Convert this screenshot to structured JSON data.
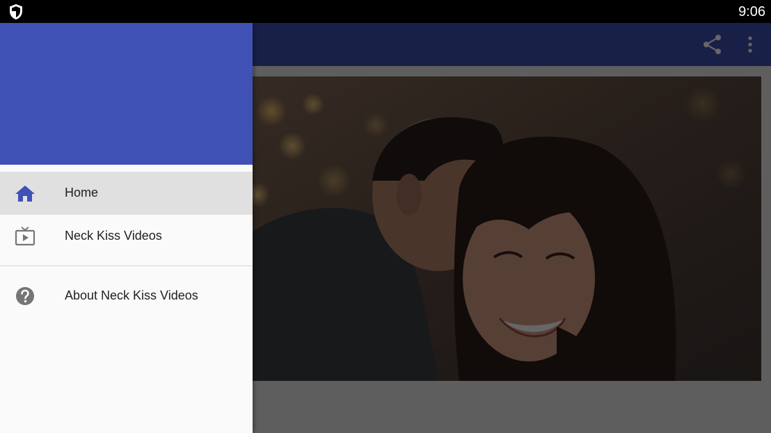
{
  "status_bar": {
    "time": "9:06",
    "security_icon": "shield-icon"
  },
  "app_bar": {
    "color": "#3f51b5",
    "actions": [
      {
        "icon": "share-icon"
      },
      {
        "icon": "more-vert-icon"
      }
    ]
  },
  "content": {
    "image": "couple-embrace-photo"
  },
  "drawer": {
    "header_color": "#3f51b5",
    "items": [
      {
        "label": "Home",
        "icon": "home-icon",
        "selected": true
      },
      {
        "label": "Neck Kiss Videos",
        "icon": "live-tv-icon",
        "selected": false
      },
      {
        "label": "About Neck Kiss Videos",
        "icon": "help-icon",
        "selected": false
      }
    ]
  },
  "colors": {
    "accent": "#3f51b5",
    "selected_background": "#e0e0e0",
    "drawer_background": "#fafafa"
  }
}
